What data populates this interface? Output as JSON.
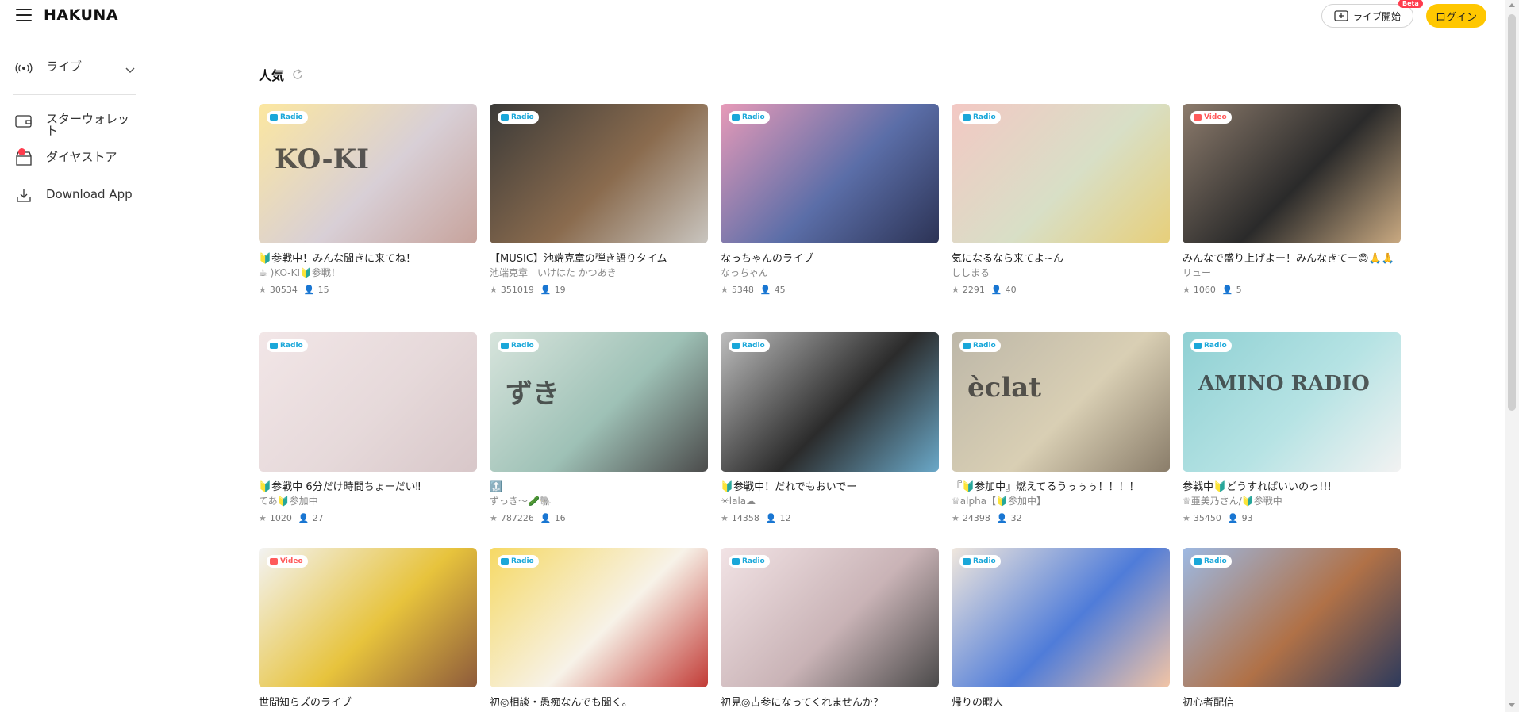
{
  "header": {
    "logo": "HAKUNA",
    "live_start_label": "ライブ開始",
    "beta_label": "Beta",
    "login_label": "ログイン"
  },
  "sidebar": {
    "items": [
      {
        "label": "ライブ",
        "icon": "broadcast-icon"
      },
      {
        "label": "スターウォレット",
        "icon": "wallet-icon"
      },
      {
        "label": "ダイヤストア",
        "icon": "store-icon"
      },
      {
        "label": "Download App",
        "icon": "download-icon"
      }
    ]
  },
  "main": {
    "section_title": "人気",
    "cards": [
      {
        "badge": "Radio",
        "title": "🔰参戦中！みんな聞きに来てね！",
        "host": "☕ )KO-KI🔰参戦！",
        "stars": "30534",
        "listeners": "15",
        "thumb_text": "KO-KI",
        "colors": [
          "#fce7a0",
          "#d8cfd6",
          "#c7a39c"
        ]
      },
      {
        "badge": "Radio",
        "title": "【MUSIC】池端克章の弾き語りタイム",
        "host": "池端克章　いけはた かつあき",
        "stars": "351019",
        "listeners": "19",
        "thumb_text": "",
        "colors": [
          "#3b3a38",
          "#8a6b4e",
          "#c9c5bf"
        ]
      },
      {
        "badge": "Radio",
        "title": "なっちゃんのライブ",
        "host": "なっちゃん",
        "stars": "5348",
        "listeners": "45",
        "thumb_text": "",
        "colors": [
          "#e79ab8",
          "#5b6ea8",
          "#2c3355"
        ]
      },
      {
        "badge": "Radio",
        "title": "気になるなら来てよ~ん",
        "host": "ししまる",
        "stars": "2291",
        "listeners": "40",
        "thumb_text": "",
        "colors": [
          "#f3c8c4",
          "#d8dfc6",
          "#e7cf7a"
        ]
      },
      {
        "badge": "Video",
        "title": "みんなで盛り上げよー！みんなきてー😊🙏🙏",
        "host": "リュー",
        "stars": "1060",
        "listeners": "5",
        "thumb_text": "",
        "colors": [
          "#8c7b6c",
          "#2a2a2a",
          "#c9a981"
        ]
      },
      {
        "badge": "Radio",
        "title": "🔰参戦中 6分だけ時間ちょーだい‼",
        "host": "てあ🔰参加中",
        "stars": "1020",
        "listeners": "27",
        "thumb_text": "",
        "colors": [
          "#f2e6e7",
          "#e6d9da",
          "#d8c7c9"
        ]
      },
      {
        "badge": "Radio",
        "title": "🔝",
        "host": "ずっき～🥒🐘",
        "stars": "787226",
        "listeners": "16",
        "thumb_text": "ずき",
        "colors": [
          "#d7e4dc",
          "#9ec1b6",
          "#4b4b4b"
        ]
      },
      {
        "badge": "Radio",
        "title": "🔰参戦中！だれでもおいでー",
        "host": "☀lala☁",
        "stars": "14358",
        "listeners": "12",
        "thumb_text": "",
        "colors": [
          "#bdbdbd",
          "#2b2b2b",
          "#6aa8c8"
        ]
      },
      {
        "badge": "Radio",
        "title": "『🔰参加中』燃えてるうぅぅぅ！！！！",
        "host": "♕alpha【🔰参加中】",
        "stars": "24398",
        "listeners": "32",
        "thumb_text": "èclat",
        "colors": [
          "#bdb7a8",
          "#d9cfb4",
          "#8a7d6a"
        ]
      },
      {
        "badge": "Radio",
        "title": "参戦中🔰どうすればいいのっ!!!",
        "host": "♕亜美乃さん/🔰参戦中",
        "stars": "35450",
        "listeners": "93",
        "thumb_text": "AMINO RADIO",
        "colors": [
          "#8fd0d3",
          "#b6e3e4",
          "#f2f2f2"
        ]
      },
      {
        "badge": "Video",
        "title": "世間知らズのライブ",
        "host": "",
        "stars": "",
        "listeners": "",
        "thumb_text": "",
        "colors": [
          "#f3f3f3",
          "#e7c33c",
          "#8d5a3b"
        ]
      },
      {
        "badge": "Radio",
        "title": "初◎相談・愚痴なんでも聞く。",
        "host": "",
        "stars": "",
        "listeners": "",
        "thumb_text": "",
        "colors": [
          "#f6d964",
          "#f7f2e8",
          "#c23b36"
        ]
      },
      {
        "badge": "Radio",
        "title": "初見◎古参になってくれませんか？",
        "host": "",
        "stars": "",
        "listeners": "",
        "thumb_text": "",
        "colors": [
          "#f2e3e5",
          "#c9b3b6",
          "#4b4a4a"
        ]
      },
      {
        "badge": "Radio",
        "title": "帰りの暇人",
        "host": "",
        "stars": "",
        "listeners": "",
        "thumb_text": "",
        "colors": [
          "#f0e7dd",
          "#4f7cd9",
          "#f2c4a5"
        ]
      },
      {
        "badge": "Radio",
        "title": "初心者配信",
        "host": "",
        "stars": "",
        "listeners": "",
        "thumb_text": "",
        "colors": [
          "#9db9e3",
          "#b07147",
          "#2d3a5c"
        ]
      }
    ]
  }
}
